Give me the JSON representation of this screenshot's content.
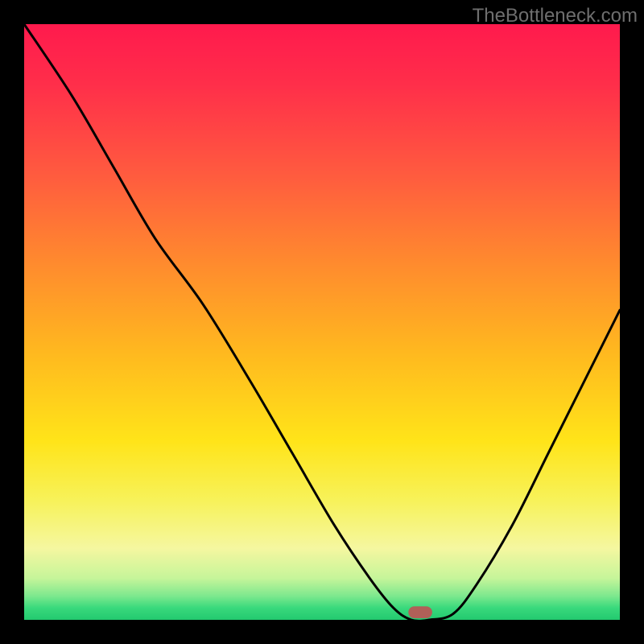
{
  "watermark": "TheBottleneck.com",
  "chart_data": {
    "type": "line",
    "title": "",
    "xlabel": "",
    "ylabel": "",
    "xlim": [
      0,
      100
    ],
    "ylim": [
      0,
      100
    ],
    "series": [
      {
        "name": "bottleneck-curve",
        "x": [
          0,
          8,
          15,
          22,
          30,
          38,
          45,
          52,
          58,
          62,
          65,
          68,
          72,
          76,
          82,
          88,
          94,
          100
        ],
        "values": [
          100,
          88,
          76,
          64,
          53,
          40,
          28,
          16,
          7,
          2,
          0,
          0,
          1,
          6,
          16,
          28,
          40,
          52
        ]
      }
    ],
    "marker": {
      "x": 66.5,
      "y": 0,
      "width": 4,
      "height": 2
    },
    "background_gradient": {
      "top_color": "#ff1a4d",
      "bottom_color": "#23c96f",
      "stops": [
        {
          "pct": 0,
          "color": "#ff1a4d"
        },
        {
          "pct": 25,
          "color": "#ff5a3f"
        },
        {
          "pct": 55,
          "color": "#ffb81f"
        },
        {
          "pct": 80,
          "color": "#f7f25a"
        },
        {
          "pct": 100,
          "color": "#23c96f"
        }
      ]
    }
  }
}
